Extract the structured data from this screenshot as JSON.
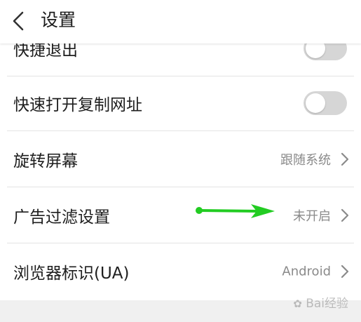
{
  "header": {
    "title": "设置",
    "back_icon": "chevron-left-icon"
  },
  "rows": [
    {
      "label": "快捷退出",
      "control": "toggle",
      "on": false
    },
    {
      "label": "快速打开复制网址",
      "control": "toggle",
      "on": false
    },
    {
      "label": "旋转屏幕",
      "value": "跟随系统",
      "control": "chevron"
    },
    {
      "label": "广告过滤设置",
      "value": "未开启",
      "control": "chevron"
    },
    {
      "label": "浏览器标识(UA)",
      "value": "Android",
      "control": "chevron"
    }
  ],
  "colors": {
    "accent_arrow": "#22cc22",
    "toggle_off": "#d6d6d6",
    "secondary_text": "#8a8a8a"
  },
  "annotation": {
    "type": "arrow",
    "color": "#22cc22"
  },
  "watermark": {
    "text": "Bai经验",
    "icon": "paw-icon"
  }
}
